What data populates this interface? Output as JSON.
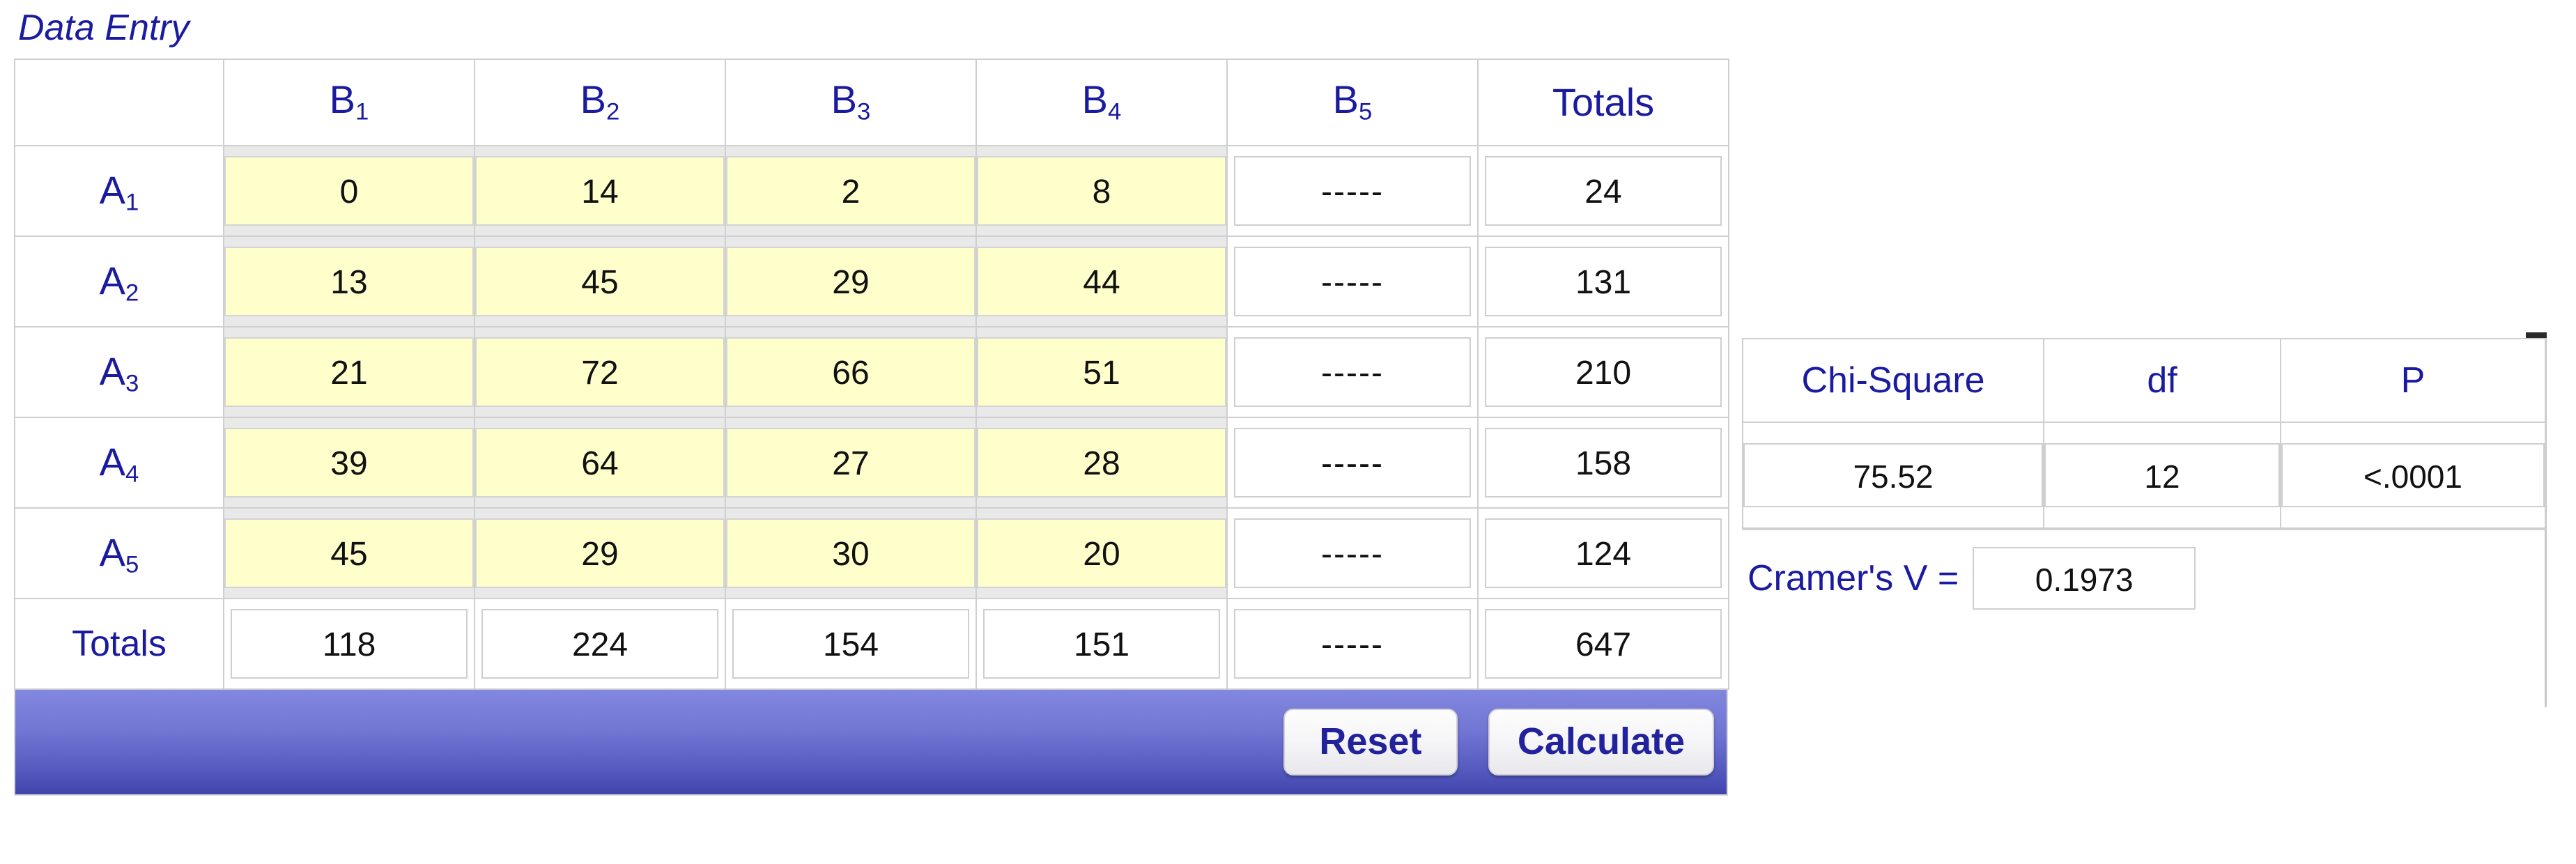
{
  "page_title": "Data Entry",
  "colors": {
    "label_blue": "#1b1ba0",
    "input_yellow": "#ffffcc",
    "bar_gradient_top": "#8287de",
    "bar_gradient_bottom": "#4044ab",
    "button_text": "#22229c",
    "grid_border": "#cfcfcf"
  },
  "table": {
    "corner_label": "",
    "column_headers": [
      {
        "base": "B",
        "sub": "1",
        "text": "B1"
      },
      {
        "base": "B",
        "sub": "2",
        "text": "B2"
      },
      {
        "base": "B",
        "sub": "3",
        "text": "B3"
      },
      {
        "base": "B",
        "sub": "4",
        "text": "B4"
      },
      {
        "base": "B",
        "sub": "5",
        "text": "B5"
      }
    ],
    "totals_header": "Totals",
    "totals_row_label": "Totals",
    "empty_marker": "-----",
    "rows": [
      {
        "label_base": "A",
        "label_sub": "1",
        "values": [
          "0",
          "14",
          "2",
          "8"
        ],
        "b5": "-----",
        "total": "24"
      },
      {
        "label_base": "A",
        "label_sub": "2",
        "values": [
          "13",
          "45",
          "29",
          "44"
        ],
        "b5": "-----",
        "total": "131"
      },
      {
        "label_base": "A",
        "label_sub": "3",
        "values": [
          "21",
          "72",
          "66",
          "51"
        ],
        "b5": "-----",
        "total": "210"
      },
      {
        "label_base": "A",
        "label_sub": "4",
        "values": [
          "39",
          "64",
          "27",
          "28"
        ],
        "b5": "-----",
        "total": "158"
      },
      {
        "label_base": "A",
        "label_sub": "5",
        "values": [
          "45",
          "29",
          "30",
          "20"
        ],
        "b5": "-----",
        "total": "124"
      }
    ],
    "column_totals": [
      "118",
      "224",
      "154",
      "151"
    ],
    "column_totals_b5": "-----",
    "grand_total": "647"
  },
  "buttons": {
    "reset_label": "Reset",
    "calculate_label": "Calculate"
  },
  "results": {
    "headers": {
      "chi_square": "Chi-Square",
      "df": "df",
      "p": "P"
    },
    "values": {
      "chi_square": "75.52",
      "df": "12",
      "p": "<.0001"
    },
    "cramers_v_label": "Cramer's V =",
    "cramers_v_value": "0.1973"
  }
}
